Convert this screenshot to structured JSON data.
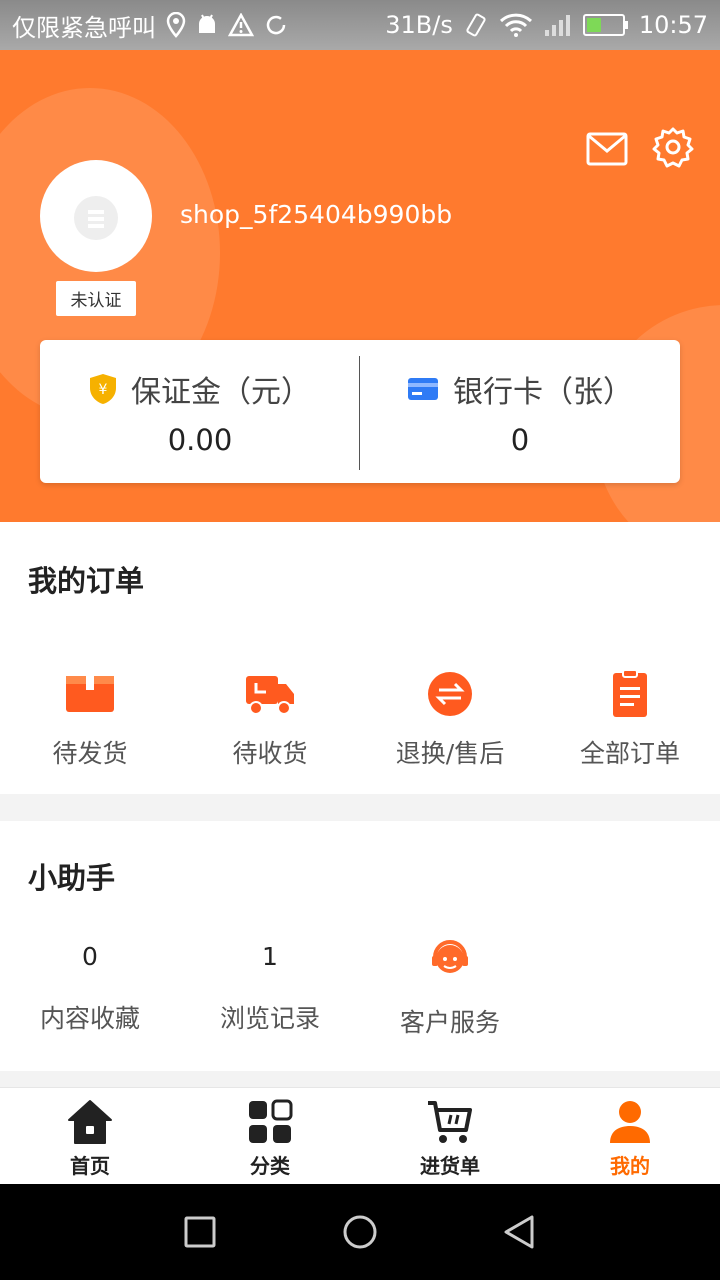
{
  "status_bar": {
    "carrier": "仅限紧急呼叫",
    "speed": "31B/s",
    "time": "10:57"
  },
  "header": {
    "username": "shop_5f25404b990bb",
    "badge": "未认证",
    "colors": {
      "primary": "#ff7a2e"
    }
  },
  "stats": {
    "deposit_label": "保证金（元）",
    "deposit_value": "0.00",
    "bank_label": "银行卡（张）",
    "bank_value": "0"
  },
  "orders": {
    "title": "我的订单",
    "items": [
      {
        "label": "待发货",
        "icon": "box-icon"
      },
      {
        "label": "待收货",
        "icon": "truck-icon"
      },
      {
        "label": "退换/售后",
        "icon": "exchange-icon"
      },
      {
        "label": "全部订单",
        "icon": "clipboard-icon"
      }
    ]
  },
  "helper": {
    "title": "小助手",
    "items": [
      {
        "count": "0",
        "label": "内容收藏"
      },
      {
        "count": "1",
        "label": "浏览记录"
      },
      {
        "label": "客户服务",
        "icon": "headset-icon"
      }
    ]
  },
  "tabbar": {
    "items": [
      {
        "label": "首页",
        "icon": "home-icon"
      },
      {
        "label": "分类",
        "icon": "grid-icon"
      },
      {
        "label": "进货单",
        "icon": "cart-icon"
      },
      {
        "label": "我的",
        "icon": "user-icon",
        "active": true
      }
    ]
  }
}
